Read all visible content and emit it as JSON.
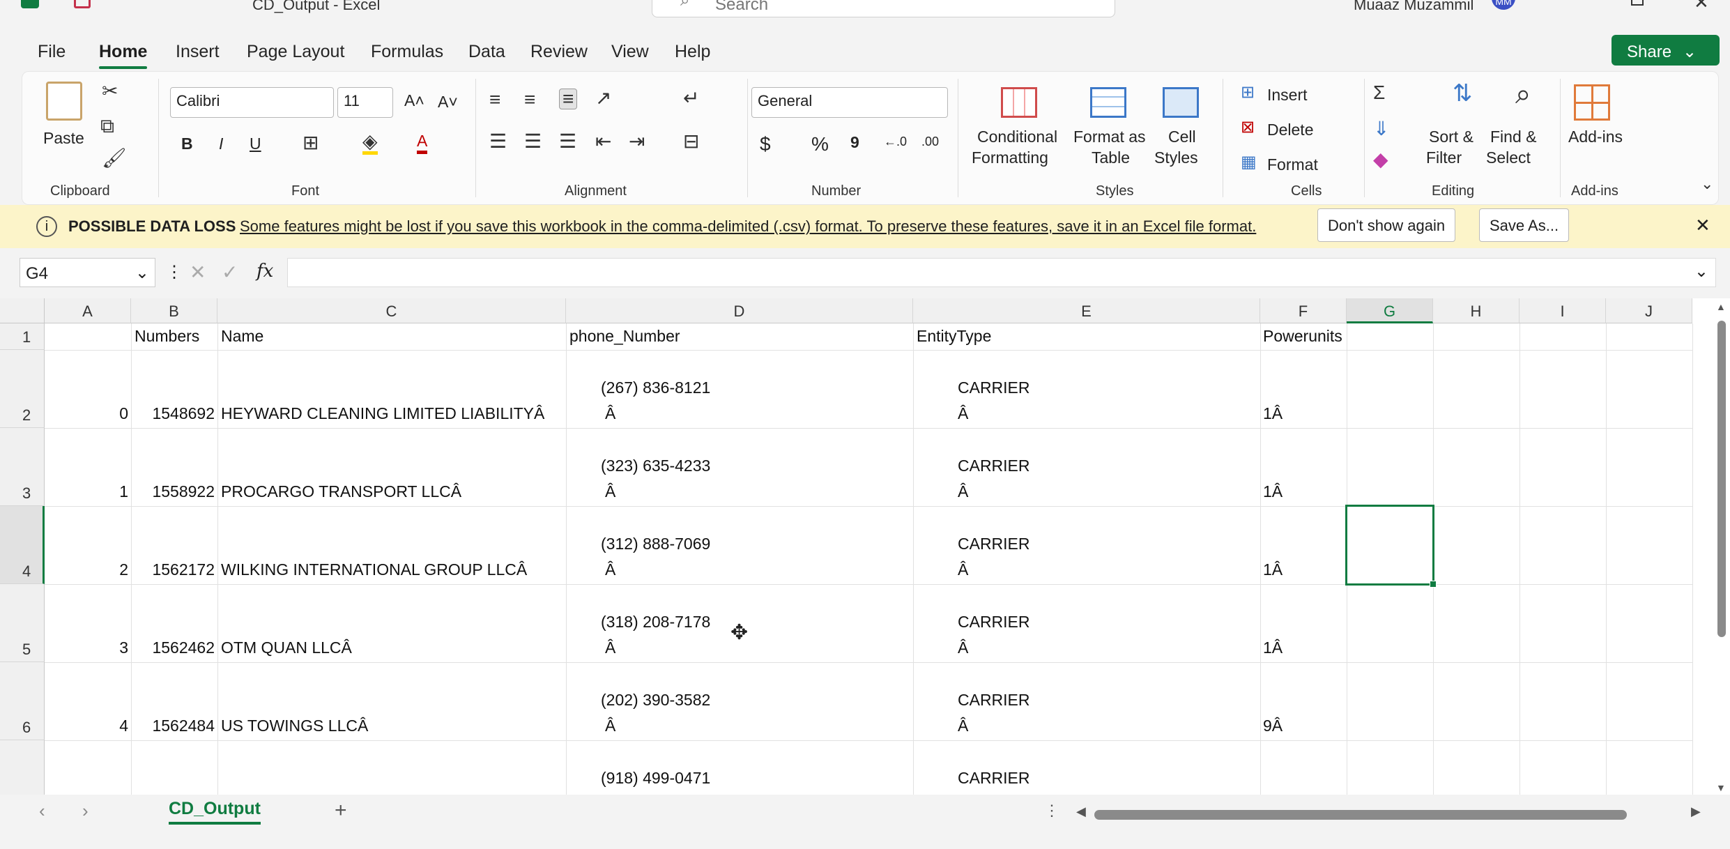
{
  "window": {
    "title": "CD_Output - Excel",
    "search_placeholder": "Search",
    "user_name": "Muaaz Muzammil",
    "user_initials": "MM"
  },
  "tabs": [
    "File",
    "Home",
    "Insert",
    "Page Layout",
    "Formulas",
    "Data",
    "Review",
    "View",
    "Help"
  ],
  "share_label": "Share",
  "ribbon": {
    "clipboard": {
      "paste": "Paste",
      "label": "Clipboard"
    },
    "font": {
      "name": "Calibri",
      "size": "11",
      "label": "Font",
      "bold": "B",
      "italic": "I",
      "underline": "U"
    },
    "alignment": {
      "label": "Alignment"
    },
    "number": {
      "format": "General",
      "label": "Number",
      "currency": "$",
      "percent": "%",
      "comma": "9"
    },
    "styles": {
      "conditional_1": "Conditional",
      "conditional_2": "Formatting",
      "format_table_1": "Format as",
      "format_table_2": "Table",
      "cell_styles_1": "Cell",
      "cell_styles_2": "Styles",
      "label": "Styles"
    },
    "cells": {
      "insert": "Insert",
      "delete": "Delete",
      "format": "Format",
      "label": "Cells"
    },
    "editing": {
      "sort_1": "Sort &",
      "sort_2": "Filter",
      "find_1": "Find &",
      "find_2": "Select",
      "label": "Editing"
    },
    "addins": {
      "button": "Add-ins",
      "label": "Add-ins"
    }
  },
  "infobar": {
    "title": "POSSIBLE DATA LOSS",
    "message": "Some features might be lost if you save this workbook in the comma-delimited (.csv) format. To preserve these features, save it in an Excel file format.",
    "dont_show": "Don't show again",
    "save_as": "Save As..."
  },
  "formula_bar": {
    "name_box": "G4",
    "fx": "fx",
    "value": ""
  },
  "columns": [
    "A",
    "B",
    "C",
    "D",
    "E",
    "F",
    "G",
    "H",
    "I",
    "J"
  ],
  "header_row": {
    "b": "Numbers",
    "c": "Name",
    "d": "phone_Number",
    "e": "EntityType",
    "f": "Powerunits"
  },
  "rows": [
    {
      "row": "2",
      "a": "0",
      "b": "1548692",
      "c": "HEYWARD CLEANING LIMITED LIABILITYÂ",
      "phone": "(267) 836-8121",
      "phone2": "Â",
      "entity": "CARRIER",
      "entity2": "Â",
      "power": "1Â"
    },
    {
      "row": "3",
      "a": "1",
      "b": "1558922",
      "c": "PROCARGO TRANSPORT LLCÂ",
      "phone": "(323) 635-4233",
      "phone2": "Â",
      "entity": "CARRIER",
      "entity2": "Â",
      "power": "1Â"
    },
    {
      "row": "4",
      "a": "2",
      "b": "1562172",
      "c": "WILKING INTERNATIONAL GROUP LLCÂ",
      "phone": "(312) 888-7069",
      "phone2": "Â",
      "entity": "CARRIER",
      "entity2": "Â",
      "power": "1Â"
    },
    {
      "row": "5",
      "a": "3",
      "b": "1562462",
      "c": "OTM QUAN LLCÂ",
      "phone": "(318) 208-7178",
      "phone2": "Â",
      "entity": "CARRIER",
      "entity2": "Â",
      "power": "1Â"
    },
    {
      "row": "6",
      "a": "4",
      "b": "1562484",
      "c": "US TOWINGS LLCÂ",
      "phone": "(202) 390-3582",
      "phone2": "Â",
      "entity": "CARRIER",
      "entity2": "Â",
      "power": "9Â"
    },
    {
      "row": "",
      "a": "",
      "b": "",
      "c": "",
      "phone": "(918) 499-0471",
      "phone2": "",
      "entity": "CARRIER",
      "entity2": "",
      "power": ""
    }
  ],
  "sheet_tab": "CD_Output",
  "colors": {
    "accent": "#107c41",
    "infobar": "#fcf4c9"
  }
}
